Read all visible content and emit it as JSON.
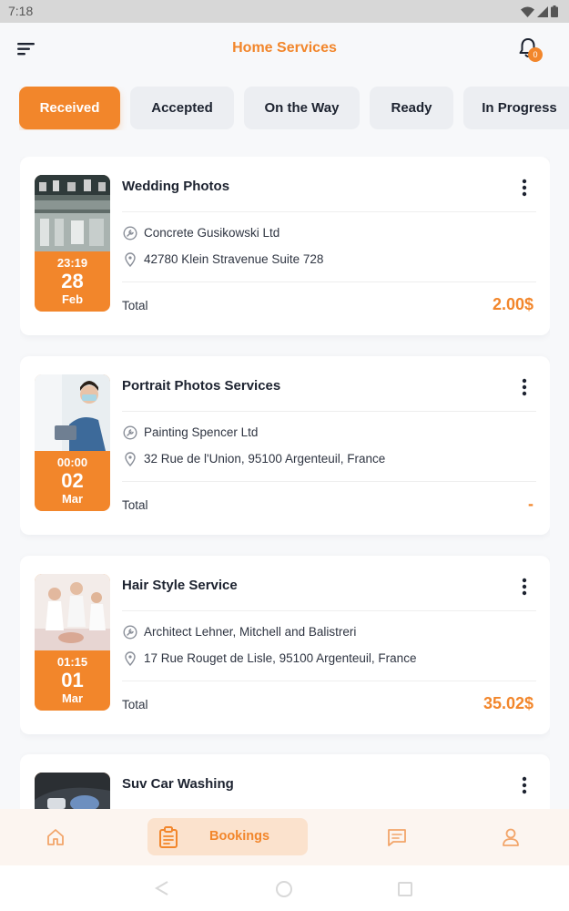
{
  "status_bar": {
    "time": "7:18"
  },
  "header": {
    "title": "Home Services",
    "notification_count": "0"
  },
  "tabs": [
    {
      "label": "Received",
      "active": true
    },
    {
      "label": "Accepted",
      "active": false
    },
    {
      "label": "On the Way",
      "active": false
    },
    {
      "label": "Ready",
      "active": false
    },
    {
      "label": "In Progress",
      "active": false
    }
  ],
  "bookings": [
    {
      "title": "Wedding Photos",
      "provider": "Concrete Gusikowski Ltd",
      "address": "42780 Klein Stravenue Suite 728",
      "time": "23:19",
      "day": "28",
      "month": "Feb",
      "total_label": "Total",
      "total": "2.00$"
    },
    {
      "title": "Portrait Photos Services",
      "provider": "Painting Spencer Ltd",
      "address": "32 Rue de l'Union, 95100 Argenteuil, France",
      "time": "00:00",
      "day": "02",
      "month": "Mar",
      "total_label": "Total",
      "total": "-"
    },
    {
      "title": "Hair Style Service",
      "provider": "Architect Lehner, Mitchell and Balistreri",
      "address": "17 Rue Rouget de Lisle, 95100 Argenteuil, France",
      "time": "01:15",
      "day": "01",
      "month": "Mar",
      "total_label": "Total",
      "total": "35.02$"
    },
    {
      "title": "Suv Car Washing"
    }
  ],
  "bottom_nav": {
    "bookings_label": "Bookings"
  },
  "colors": {
    "accent": "#f2862b",
    "text": "#1d2330",
    "background": "#f7f8fa"
  }
}
